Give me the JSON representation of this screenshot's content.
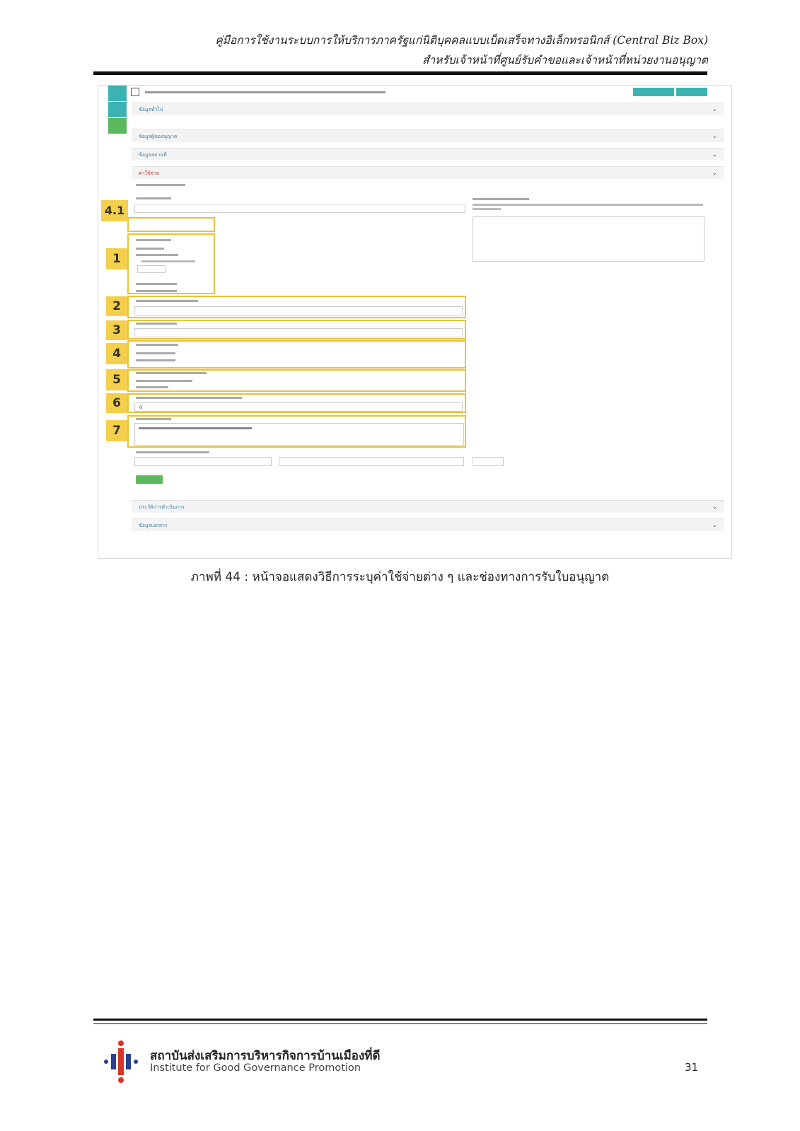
{
  "header": {
    "line1": "คู่มือการใช้งานระบบการให้บริการภาครัฐแก่นิติบุคคลแบบเบ็ดเสร็จทางอิเล็กทรอนิกส์ (Central Biz Box)",
    "line2": "สำหรับเจ้าหน้าที่ศูนย์รับคำขอและเจ้าหน้าที่หน่วยงานอนุญาต"
  },
  "screenshot": {
    "sections_top": [
      "ข้อมูลทั่วไป",
      "ข้อมูลผู้ขออนุญาต",
      "ข้อมูลสถานที่"
    ],
    "active_section": "ค่าใช้จ่าย",
    "sections_bottom": [
      "ประวัติการดำเนินการ",
      "ข้อมูลเอกสาร"
    ],
    "textarea_initial": "",
    "notes_label": "ความคิดเห็น",
    "field_6_value": "0"
  },
  "markers": [
    "4.1",
    "1",
    "2",
    "3",
    "4",
    "5",
    "6",
    "7"
  ],
  "caption": "ภาพที่ 44 : หน้าจอแสดงวิธีการระบุค่าใช้จ่ายต่าง ๆ และช่องทางการรับใบอนุญาต",
  "footer": {
    "org_th": "สถาบันส่งเสริมการบริหารกิจการบ้านเมืองที่ดี",
    "org_en": "Institute for Good Governance Promotion",
    "page_number": "31"
  },
  "colors": {
    "marker_yellow": "#f3cf4c",
    "teal": "#3bb3b3",
    "green": "#5cb85c"
  }
}
